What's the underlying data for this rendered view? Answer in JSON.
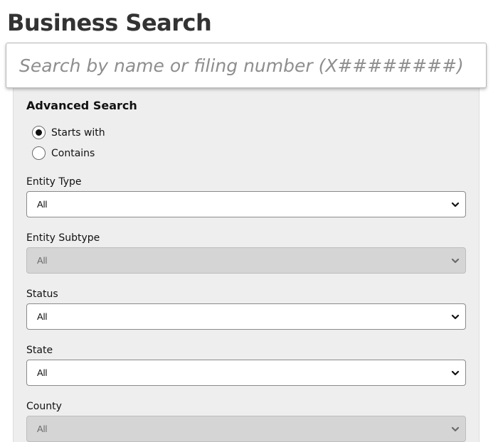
{
  "page": {
    "title": "Business Search"
  },
  "search": {
    "placeholder": "Search by name or filing number (X########)",
    "value": ""
  },
  "advanced": {
    "title": "Advanced Search",
    "match_options": [
      {
        "label": "Starts with",
        "checked": true
      },
      {
        "label": "Contains",
        "checked": false
      }
    ],
    "fields": {
      "entity_type": {
        "label": "Entity Type",
        "value": "All",
        "disabled": false
      },
      "entity_subtype": {
        "label": "Entity Subtype",
        "value": "All",
        "disabled": true
      },
      "status": {
        "label": "Status",
        "value": "All",
        "disabled": false
      },
      "state": {
        "label": "State",
        "value": "All",
        "disabled": false
      },
      "county": {
        "label": "County",
        "value": "All",
        "disabled": true
      }
    }
  },
  "icons": {
    "dropdown": "chevron-down-icon"
  },
  "colors": {
    "panel_bg": "#eeeeee",
    "disabled_select_bg": "#d5d5d5",
    "title_text": "#333333"
  }
}
